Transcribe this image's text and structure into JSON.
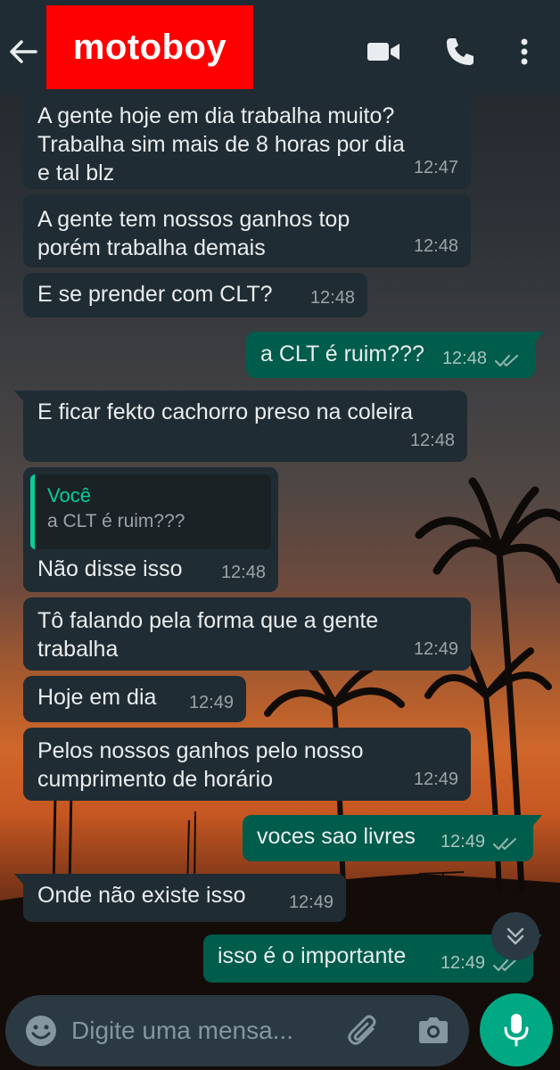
{
  "header": {
    "title": "motoboy",
    "back_icon": "arrow-left-icon",
    "video_icon": "video-camera-icon",
    "call_icon": "phone-icon",
    "menu_icon": "more-vertical-icon"
  },
  "messages": [
    {
      "dir": "in",
      "lines": [
        "A gente hoje em dia trabalha muito?",
        "Trabalha sim mais de 8 horas por dia",
        "e tal blz"
      ],
      "time": "12:47"
    },
    {
      "dir": "in",
      "lines": [
        "A gente tem nossos ganhos top",
        "porém trabalha demais"
      ],
      "time": "12:48"
    },
    {
      "dir": "in",
      "lines": [
        "E se prender com CLT?"
      ],
      "time": "12:48"
    },
    {
      "dir": "out",
      "lines": [
        "a CLT é ruim???"
      ],
      "time": "12:48"
    },
    {
      "dir": "in",
      "lines": [
        "E ficar fekto cachorro preso na coleira"
      ],
      "time": "12:48"
    },
    {
      "dir": "in",
      "quote_author": "Você",
      "quote_text": "a CLT é ruim???",
      "lines": [
        "Não disse isso"
      ],
      "time": "12:48"
    },
    {
      "dir": "in",
      "lines": [
        "Tô falando pela forma que a gente",
        "trabalha"
      ],
      "time": "12:49"
    },
    {
      "dir": "in",
      "lines": [
        "Hoje em dia"
      ],
      "time": "12:49"
    },
    {
      "dir": "in",
      "lines": [
        "Pelos nossos ganhos pelo nosso",
        "cumprimento de horário"
      ],
      "time": "12:49"
    },
    {
      "dir": "out",
      "lines": [
        "voces sao livres"
      ],
      "time": "12:49"
    },
    {
      "dir": "in",
      "lines": [
        "Onde não existe isso"
      ],
      "time": "12:49"
    },
    {
      "dir": "out",
      "lines": [
        "isso é o importante"
      ],
      "time": "12:49"
    }
  ],
  "composer": {
    "placeholder": "Digite uma mensa...",
    "emoji_icon": "emoji-icon",
    "attach_icon": "paperclip-icon",
    "camera_icon": "camera-icon",
    "mic_icon": "microphone-icon",
    "scroll_icon": "double-chevron-down-icon"
  },
  "colors": {
    "header_bg": "#202c33",
    "title_bg": "#ff0000",
    "incoming_bubble": "#202c33",
    "outgoing_bubble": "#005c4b",
    "accent": "#00a884",
    "read_ticks": "#8bb3aa"
  }
}
